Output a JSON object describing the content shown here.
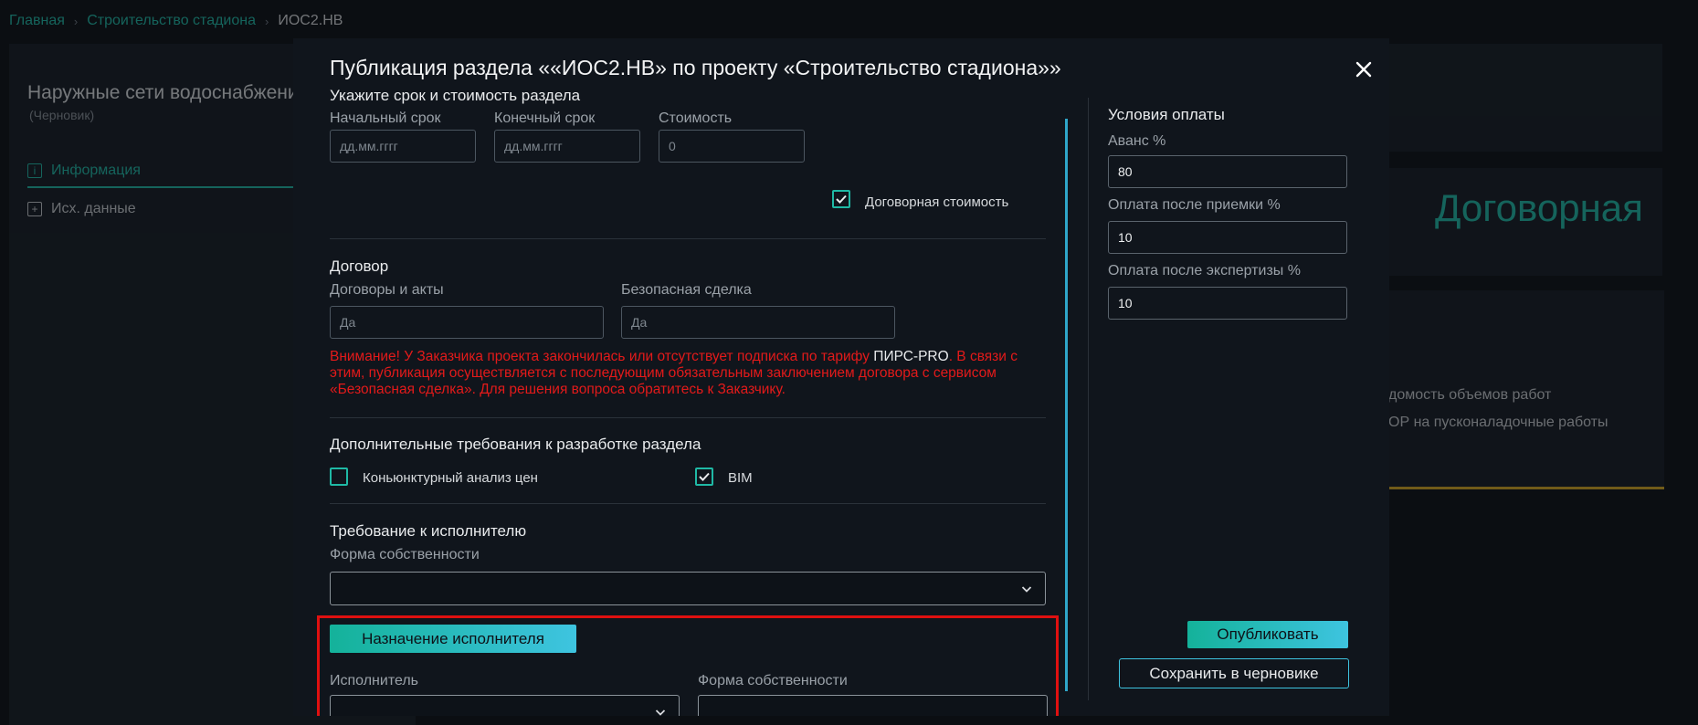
{
  "breadcrumb": {
    "home": "Главная",
    "project": "Строительство стадиона",
    "current": "ИОС2.НВ"
  },
  "background": {
    "section_title": "Наружные сети водоснабжения",
    "section_status": "(Черновик)",
    "tab_info": "Информация",
    "tab_source": "Исх. данные",
    "price_text": "Договорная",
    "list_item_1": "домость объемов работ",
    "list_item_2": "ОР на пусконаладочные работы"
  },
  "modal": {
    "title": "Публикация раздела ««ИОС2.НВ» по проекту «Строительство стадиона»»",
    "close_icon": "close-icon",
    "term_section": {
      "header": "Укажите срок и стоимость раздела",
      "start_label": "Начальный срок",
      "start_placeholder": "дд.мм.гггг",
      "end_label": "Конечный срок",
      "end_placeholder": "дд.мм.гггг",
      "cost_label": "Стоимость",
      "cost_placeholder": "0",
      "negotiable_label": "Договорная стоимость",
      "negotiable_checked": true
    },
    "contract": {
      "header": "Договор",
      "acts_label": "Договоры и акты",
      "acts_value": "Да",
      "safe_deal_label": "Безопасная сделка",
      "safe_deal_value": "Да",
      "warning_part1": "Внимание! У Заказчика проекта закончилась или отсутствует подписка по тарифу ",
      "warning_plan": "ПИРС-PRO",
      "warning_part2": ". В связи с этим, публикация осуществляется с последующим обязательным заключением договора с сервисом «Безопасная сделка». Для решения вопроса обратитесь к Заказчику."
    },
    "extra_requirements": {
      "header": "Дополнительные требования к разработке раздела",
      "market_analysis_label": "Коньюнктурный анализ цен",
      "market_analysis_checked": false,
      "bim_label": "BIM",
      "bim_checked": true
    },
    "executor_requirements": {
      "header": "Требование к исполнителю",
      "ownership_label": "Форма собственности",
      "ownership_value": ""
    },
    "assignment": {
      "button_label": "Назначение исполнителя",
      "executor_label": "Исполнитель",
      "executor_value": "",
      "ownership_label": "Форма собственности",
      "ownership_value": ""
    },
    "payment": {
      "header": "Условия оплаты",
      "advance_label": "Аванс %",
      "advance_value": "80",
      "after_acceptance_label": "Оплата после приемки %",
      "after_acceptance_value": "10",
      "after_expertise_label": "Оплата после экспертизы %",
      "after_expertise_value": "10"
    },
    "actions": {
      "publish_label": "Опубликовать",
      "draft_label": "Сохранить в черновике"
    }
  },
  "colors": {
    "accent": "#1fb9a5",
    "gradient_end": "#3ec4e0",
    "warning": "#e31a1a",
    "highlight_box": "#e01010"
  }
}
